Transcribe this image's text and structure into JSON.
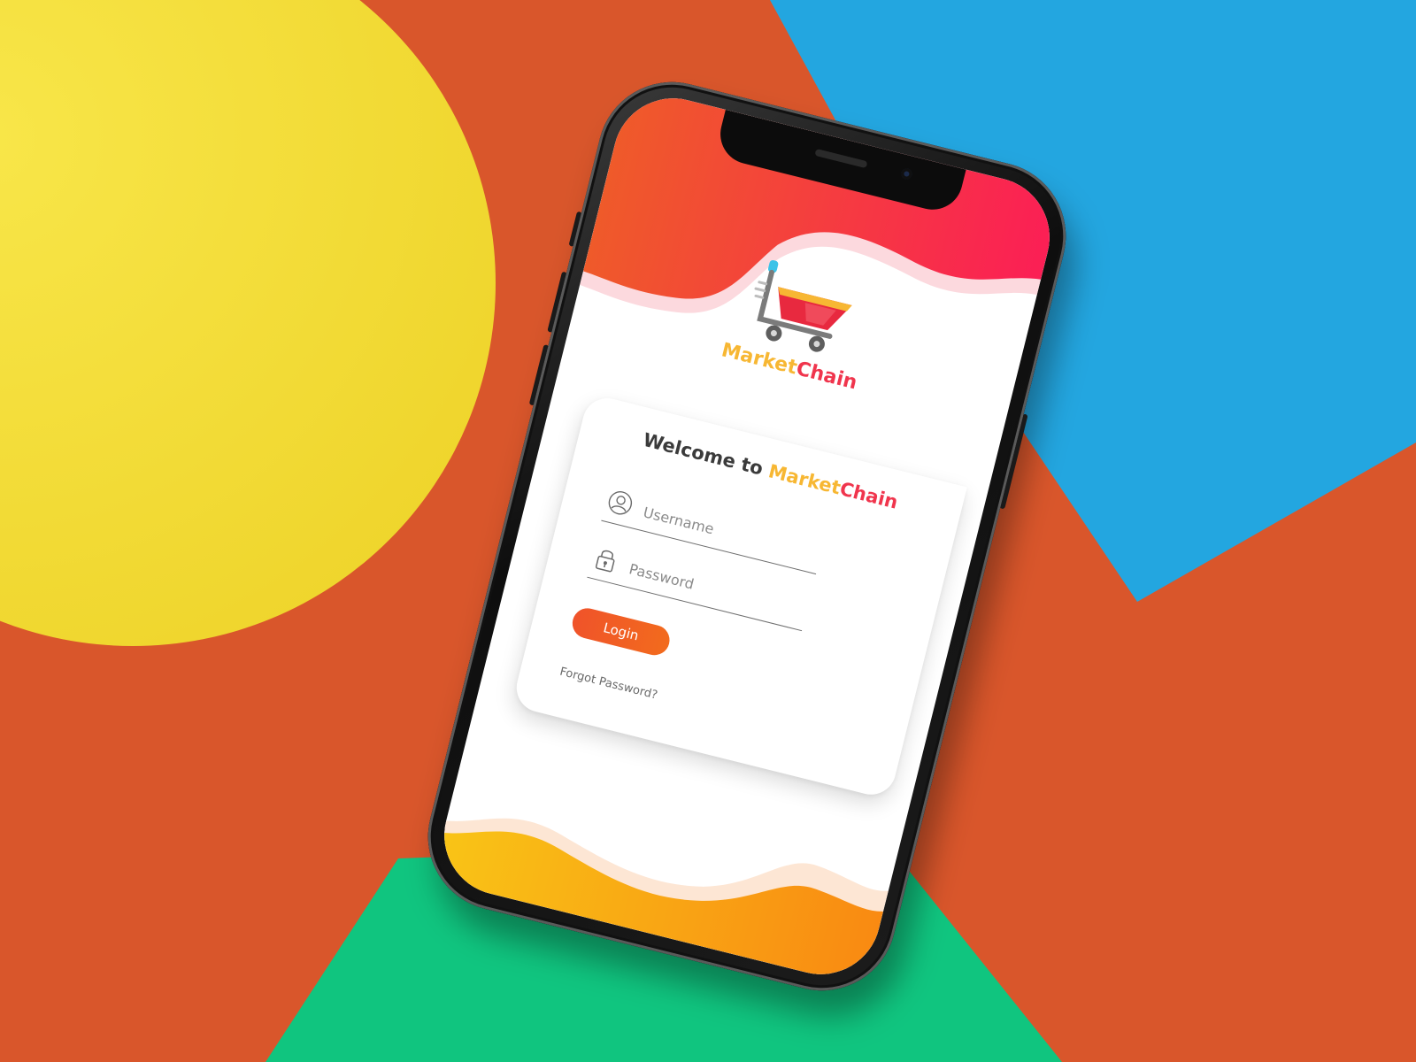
{
  "app": {
    "brand_part1": "Market",
    "brand_part2": "Chain"
  },
  "login": {
    "welcome_prefix": "Welcome to ",
    "brand_part1": "Market",
    "brand_part2": "Chain",
    "username_placeholder": "Username",
    "password_placeholder": "Password",
    "login_label": "Login",
    "forgot_label": "Forgot Password?"
  },
  "icons": {
    "cart": "shopping-cart-icon",
    "user": "user-icon",
    "lock": "lock-icon"
  },
  "colors": {
    "bg_orange": "#d9562b",
    "bg_yellow": "#f5e03a",
    "bg_blue": "#23a6e0",
    "bg_green": "#10c57f",
    "accent_orange": "#f0532a",
    "accent_pink": "#f0354d",
    "accent_yellow": "#f7b733"
  }
}
